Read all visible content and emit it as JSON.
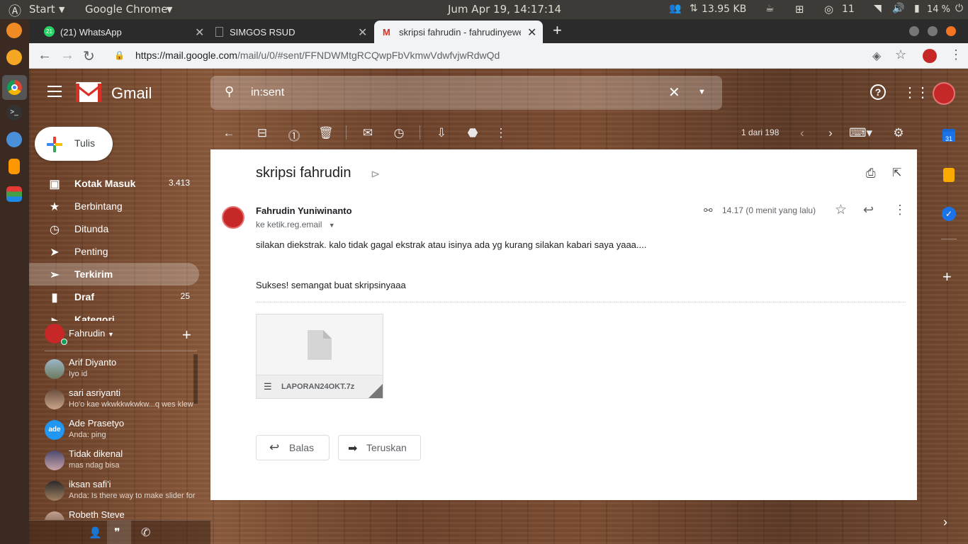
{
  "system": {
    "start_label": "Start",
    "app_label": "Google Chrome",
    "clock": "Jum Apr 19, 14:17:14",
    "network_speed": "13.95 KB",
    "notif_count": "11",
    "battery": "14 %"
  },
  "tabs": [
    {
      "label": "(21) WhatsApp",
      "badge": "21"
    },
    {
      "label": "SIMGOS RSUD"
    },
    {
      "label": "skripsi fahrudin - fahrudinyewe("
    }
  ],
  "address": {
    "host": "https://mail.google.com",
    "path": "/mail/u/0/#sent/FFNDWMtgRCQwpFbVkmwVdwfvjwRdwQd"
  },
  "header": {
    "app_name": "Gmail",
    "search_query": "in:sent"
  },
  "toolbar": {
    "page_info": "1 dari 198"
  },
  "compose_label": "Tulis",
  "nav": [
    {
      "label": "Kotak Masuk",
      "count": "3.413"
    },
    {
      "label": "Berbintang",
      "count": ""
    },
    {
      "label": "Ditunda",
      "count": ""
    },
    {
      "label": "Penting",
      "count": ""
    },
    {
      "label": "Terkirim",
      "count": ""
    },
    {
      "label": "Draf",
      "count": "25"
    },
    {
      "label": "Kategori",
      "count": ""
    }
  ],
  "hangouts": {
    "user": "Fahrudin",
    "contacts": [
      {
        "name": "Arif Diyanto",
        "msg": "Iyo id"
      },
      {
        "name": "sari asriyanti",
        "msg": "Ho'o kae wkwkkwkwkw...q wes klew"
      },
      {
        "name": "Ade Prasetyo",
        "msg": "Anda: ping"
      },
      {
        "name": "Tidak dikenal",
        "msg": "mas ndag bisa"
      },
      {
        "name": "iksan safi'i",
        "msg": "Anda: Is there way to make slider for"
      },
      {
        "name": "Robeth Steve",
        "msg": ""
      }
    ]
  },
  "email": {
    "subject": "skripsi fahrudin",
    "sender": "Fahrudin Yuniwinanto",
    "recipient": "ke ketik.reg.email",
    "time": "14.17 (0 menit yang lalu)",
    "body": [
      "silakan diekstrak. kalo tidak gagal ekstrak atau isinya ada yg kurang silakan kabari saya yaaa....",
      "Sukses! semangat buat skripsinyaaa"
    ],
    "attachment": "LAPORAN24OKT.7z",
    "reply_label": "Balas",
    "forward_label": "Teruskan"
  },
  "side_calendar_day": "31",
  "colors": {
    "gmail_red": "#d93025",
    "accent_blue": "#1a73e8",
    "keep_yellow": "#f9ab00"
  }
}
